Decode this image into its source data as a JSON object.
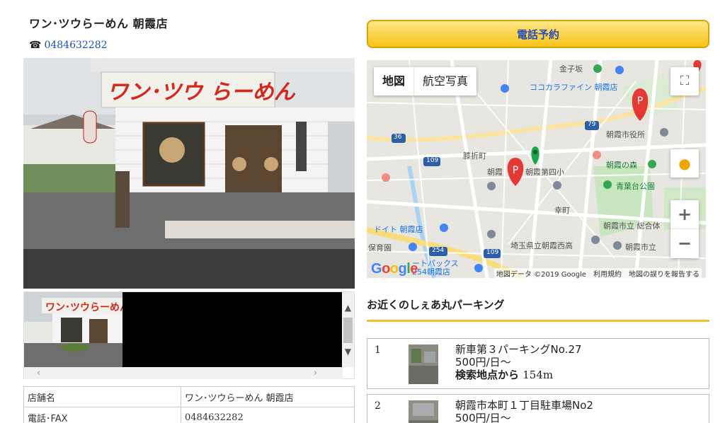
{
  "shop": {
    "name": "ワン･ツウらーめん 朝霞店",
    "phone_icon": "☎",
    "phone": "0484632282"
  },
  "reserve_button": {
    "label": "電話予約"
  },
  "map": {
    "type_map": "地図",
    "type_satellite": "航空写真",
    "zoom_in": "+",
    "zoom_out": "−",
    "fullscreen_glyph": "⛶",
    "google": "Google",
    "attribution": "地図データ ©2019 Google　利用規約　地図の誤りを報告する",
    "labels": {
      "kanekozaka": "金子坂",
      "cocokara": "ココカラファイン 朝霞店",
      "asaka_city_hall": "朝霞市役所",
      "hiraki_machi": "膝折町",
      "asaka_dai4": "朝霞第四小",
      "asaka_forest": "朝霞の森",
      "aobadai_park": "青葉台公園",
      "saiwai_cho": "幸町",
      "asaka_sogo": "朝霞市立 総合体",
      "drug_asaka": "ドイト 朝霞店",
      "hoikuen": "保育園",
      "saitama_asakanishi": "埼玉県立朝霞西高",
      "asaka_shiritsu": "朝霞市立",
      "parks254": "ートパックス 254朝霞店",
      "asaka_lbl": "朝霞",
      "road36": "36",
      "road109a": "109",
      "road109b": "109",
      "road79": "79",
      "road254": "254"
    }
  },
  "info_table": [
    {
      "key": "店舗名",
      "value": "ワン･ツウらーめん 朝霞店"
    },
    {
      "key": "電話･FAX",
      "value": "0484632282"
    }
  ],
  "nearby": {
    "title": "お近くのしぇあ丸パーキング",
    "items": [
      {
        "num": "1",
        "name": "新車第３パーキングNo.27",
        "price": "500円/日～",
        "dist_label": "検索地点から",
        "dist": "154m"
      },
      {
        "num": "2",
        "name": "朝霞市本町１丁目駐車場No2",
        "price": "500円/日～"
      }
    ]
  },
  "colors": {
    "link": "#1a4fbf",
    "button_top": "#fde88a",
    "button_bottom": "#f7c316",
    "accent_rule": "#f4c12d",
    "map_pin": "#e53935"
  }
}
